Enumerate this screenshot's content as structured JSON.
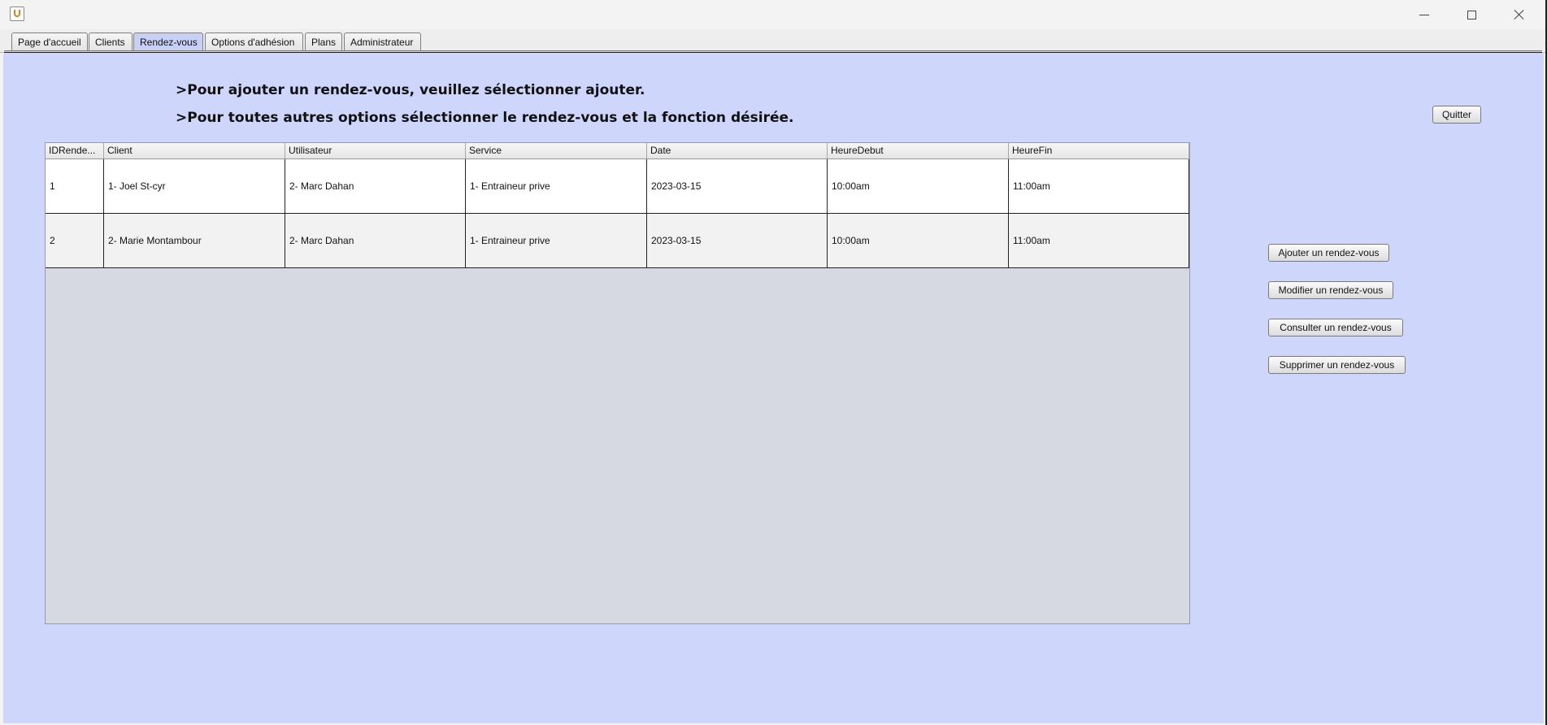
{
  "window": {
    "controls": {
      "minimize_icon": "minimize-icon",
      "maximize_icon": "maximize-icon",
      "close_icon": "close-icon"
    }
  },
  "tabs": [
    {
      "label": "Page d'accueil",
      "active": false
    },
    {
      "label": "Clients",
      "active": false
    },
    {
      "label": "Rendez-vous",
      "active": true
    },
    {
      "label": "Options d'adhésion",
      "active": false
    },
    {
      "label": "Plans",
      "active": false
    },
    {
      "label": "Administrateur",
      "active": false
    }
  ],
  "instructions": {
    "line1": ">Pour ajouter un rendez-vous, veuillez sélectionner ajouter.",
    "line2": ">Pour toutes autres options sélectionner le rendez-vous et la fonction désirée."
  },
  "buttons": {
    "quit": "Quitter",
    "add": "Ajouter un rendez-vous",
    "modify": "Modifier un rendez-vous",
    "consult": "Consulter un rendez-vous",
    "delete": "Supprimer un rendez-vous"
  },
  "table": {
    "columns": [
      "IDRende...",
      "Client",
      "Utilisateur",
      "Service",
      "Date",
      "HeureDebut",
      "HeureFin"
    ],
    "rows": [
      [
        "1",
        "1- Joel St-cyr",
        "2- Marc Dahan",
        "1- Entraineur prive",
        "2023-03-15",
        "10:00am",
        "11:00am"
      ],
      [
        "2",
        "2- Marie Montambour",
        "2- Marc Dahan",
        "1- Entraineur prive",
        "2023-03-15",
        "10:00am",
        "11:00am"
      ]
    ]
  },
  "colors": {
    "panel_background": "#cfd6fb",
    "active_tab": "#c8d0f5",
    "table_empty_area": "#d6d9e2"
  }
}
